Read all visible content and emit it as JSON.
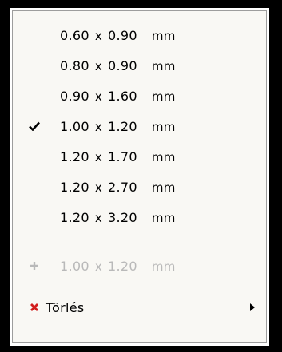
{
  "menu": {
    "size_items": [
      {
        "w": "0.60",
        "h": "0.90",
        "unit": "mm",
        "checked": false
      },
      {
        "w": "0.80",
        "h": "0.90",
        "unit": "mm",
        "checked": false
      },
      {
        "w": "0.90",
        "h": "1.60",
        "unit": "mm",
        "checked": false
      },
      {
        "w": "1.00",
        "h": "1.20",
        "unit": "mm",
        "checked": true
      },
      {
        "w": "1.20",
        "h": "1.70",
        "unit": "mm",
        "checked": false
      },
      {
        "w": "1.20",
        "h": "2.70",
        "unit": "mm",
        "checked": false
      },
      {
        "w": "1.20",
        "h": "3.20",
        "unit": "mm",
        "checked": false
      }
    ],
    "times": "x",
    "add_item": {
      "w": "1.00",
      "h": "1.20",
      "unit": "mm",
      "enabled": false
    },
    "delete_item": {
      "label": "Törlés",
      "has_submenu": true
    },
    "icons": {
      "check": "checkmark-icon",
      "add": "plus-icon",
      "delete": "red-x-icon",
      "submenu": "triangle-right-icon"
    },
    "colors": {
      "delete_icon": "#d21d1d",
      "disabled_text": "#b9b9b9",
      "menu_background": "#f9f8f4"
    }
  }
}
